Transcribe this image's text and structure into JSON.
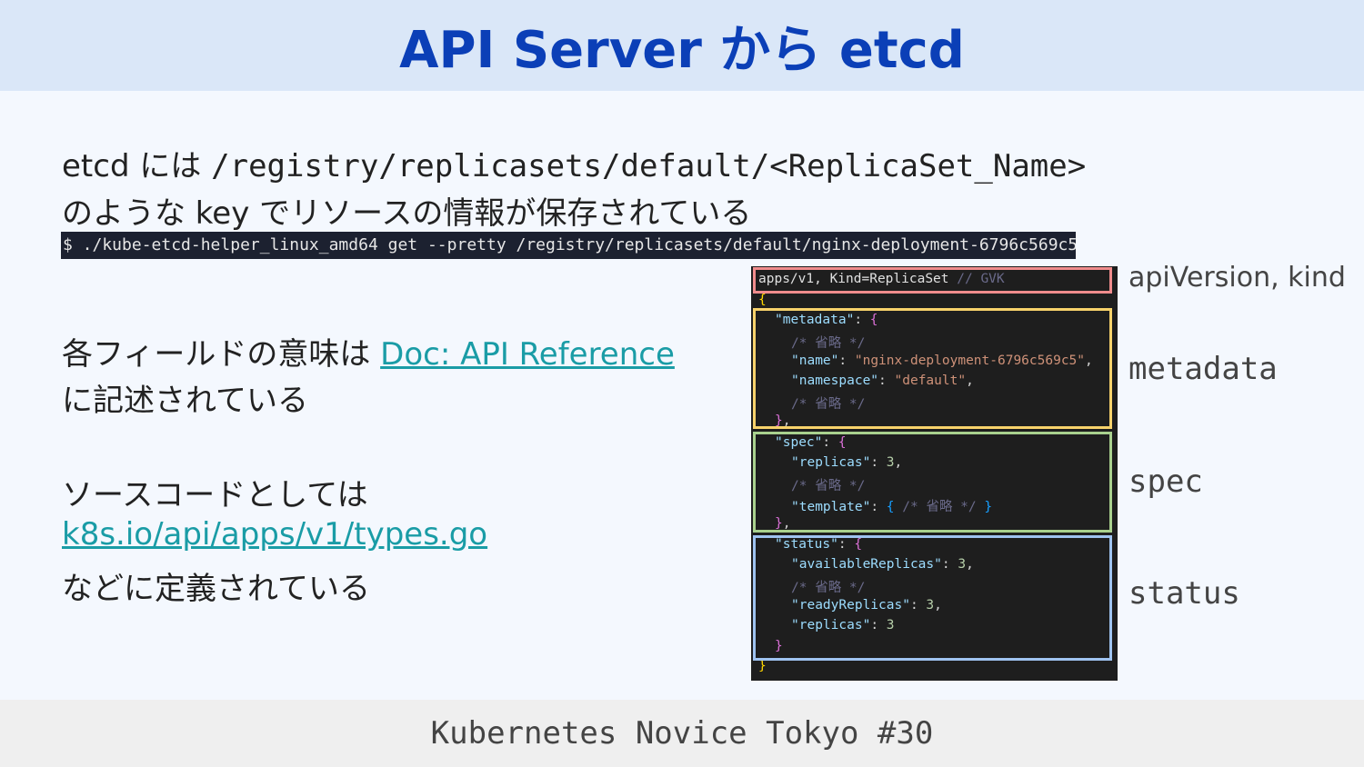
{
  "header": {
    "title": "API Server から etcd"
  },
  "intro": {
    "line1_prefix": "etcd には ",
    "line1_path": "/registry/replicasets/default/<ReplicaSet_Name>",
    "line2": "のような key でリソースの情報が保存されている"
  },
  "command": "$ ./kube-etcd-helper_linux_amd64 get --pretty /registry/replicasets/default/nginx-deployment-6796c569c5",
  "fields": {
    "line1_prefix": "各フィールドの意味は ",
    "line1_link": "Doc: API Reference",
    "line2": "に記述されている"
  },
  "source": {
    "line1": "ソースコードとしては",
    "link": "k8s.io/api/apps/v1/types.go",
    "line3": "などに定義されている"
  },
  "code": {
    "gvk": "apps/v1, Kind=ReplicaSet",
    "gvk_comment": "// GVK",
    "omitted": "/* 省略 */",
    "metadata_key": "\"metadata\"",
    "name_key": "\"name\"",
    "name_value": "\"nginx-deployment-6796c569c5\"",
    "namespace_key": "\"namespace\"",
    "namespace_value": "\"default\"",
    "spec_key": "\"spec\"",
    "replicas_key": "\"replicas\"",
    "replicas_value": "3",
    "template_key": "\"template\"",
    "status_key": "\"status\"",
    "available_key": "\"availableReplicas\"",
    "available_value": "3",
    "ready_key": "\"readyReplicas\"",
    "ready_value": "3",
    "status_replicas_key": "\"replicas\"",
    "status_replicas_value": "3"
  },
  "side_labels": {
    "gvk": "apiVersion, kind",
    "metadata": "metadata",
    "spec": "spec",
    "status": "status"
  },
  "colors": {
    "gvk_box": "#f08c8c",
    "metadata_box": "#f7d26b",
    "spec_box": "#a9d18e",
    "status_box": "#9fc3f0"
  },
  "footer": {
    "text": "Kubernetes Novice Tokyo #30"
  }
}
